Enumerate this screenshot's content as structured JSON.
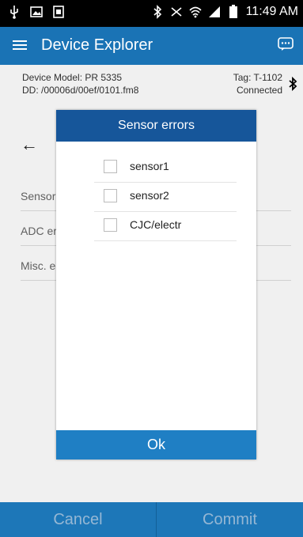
{
  "status_bar": {
    "time": "11:49 AM",
    "left_icons": [
      "usb-icon",
      "image-icon",
      "screenshot-icon"
    ],
    "right_icons": [
      "bluetooth-icon",
      "mute-icon",
      "wifi-icon",
      "signal-icon",
      "battery-icon"
    ]
  },
  "app_bar": {
    "title": "Device Explorer",
    "menu_icon": "hamburger-menu-icon",
    "action_icon": "chat-icon",
    "color": "#1a73b5"
  },
  "device_info": {
    "model": "Device Model: PR 5335",
    "dd": "DD: /00006d/00ef/0101.fm8",
    "tag": "Tag: T-1102",
    "status": "Connected",
    "bluetooth_icon": "bluetooth-icon"
  },
  "content": {
    "back_icon": "back-arrow-icon",
    "rows": [
      {
        "label": "Sensor"
      },
      {
        "label": "ADC er"
      },
      {
        "label": "Misc. e"
      }
    ]
  },
  "dialog": {
    "title": "Sensor errors",
    "items": [
      {
        "label": "sensor1",
        "checked": false
      },
      {
        "label": "sensor2",
        "checked": false
      },
      {
        "label": "CJC/electr",
        "checked": false
      }
    ],
    "ok_label": "Ok"
  },
  "footer": {
    "cancel_label": "Cancel",
    "commit_label": "Commit"
  }
}
